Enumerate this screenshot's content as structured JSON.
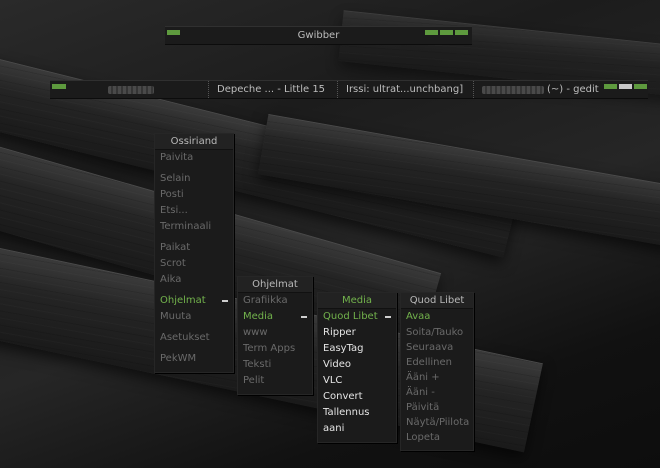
{
  "top_bar": {
    "title": "Gwibber"
  },
  "taskbar": {
    "items": [
      {
        "label": "",
        "blurred": true
      },
      {
        "label": "Depeche ... - Little 15",
        "blurred": false
      },
      {
        "label": "Irssi: ultrat...unchbang]",
        "blurred": false
      },
      {
        "label": "(~) - gedit",
        "blurred": true
      }
    ]
  },
  "menus": {
    "root": {
      "title": "Ossiriand",
      "items": [
        "Paivita",
        "Selain",
        "Posti",
        "Etsi...",
        "Terminaali",
        "Paikat",
        "Scrot",
        "Aika",
        "Ohjelmat",
        "Muuta",
        "Asetukset",
        "PekWM"
      ]
    },
    "ohjelmat": {
      "title": "Ohjelmat",
      "items": [
        "Grafiikka",
        "Media",
        "www",
        "Term Apps",
        "Teksti",
        "Pelit"
      ]
    },
    "media": {
      "title": "Media",
      "items": [
        "Quod Libet",
        "Ripper",
        "EasyTag",
        "Video",
        "VLC",
        "Convert",
        "Tallennus",
        "aani"
      ]
    },
    "quodlibet": {
      "title": "Quod Libet",
      "items": [
        "Avaa",
        "Soita/Tauko",
        "Seuraava",
        "Edellinen",
        "Ääni +",
        "Ääni -",
        "Päivitä",
        "Näytä/Piilota",
        "Lopeta"
      ]
    }
  },
  "colors": {
    "accent": "#72b24c",
    "menu_bg": "#1b1b1b",
    "text_dim": "#6a6a6a",
    "text_bright": "#e6e6e6"
  }
}
